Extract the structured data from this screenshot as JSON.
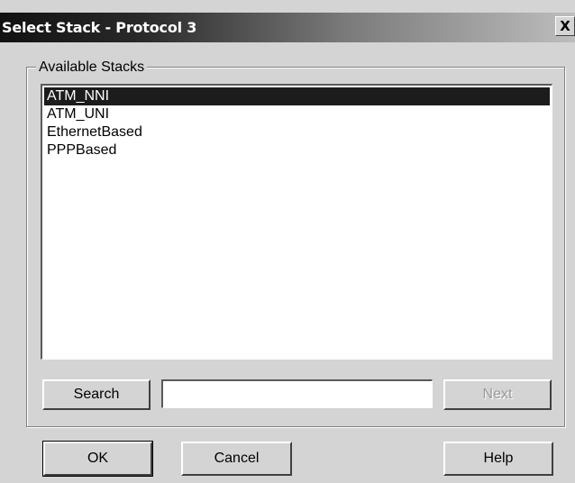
{
  "window": {
    "title": "Select Stack - Protocol 3",
    "close_glyph": "X"
  },
  "group": {
    "label": "Available Stacks"
  },
  "stacks": [
    {
      "label": "ATM_NNI",
      "selected": true
    },
    {
      "label": "ATM_UNI",
      "selected": false
    },
    {
      "label": "EthernetBased",
      "selected": false
    },
    {
      "label": "PPPBased",
      "selected": false
    }
  ],
  "search": {
    "button_label": "Search",
    "value": "",
    "next_label": "Next"
  },
  "buttons": {
    "ok": "OK",
    "cancel": "Cancel",
    "help": "Help"
  }
}
